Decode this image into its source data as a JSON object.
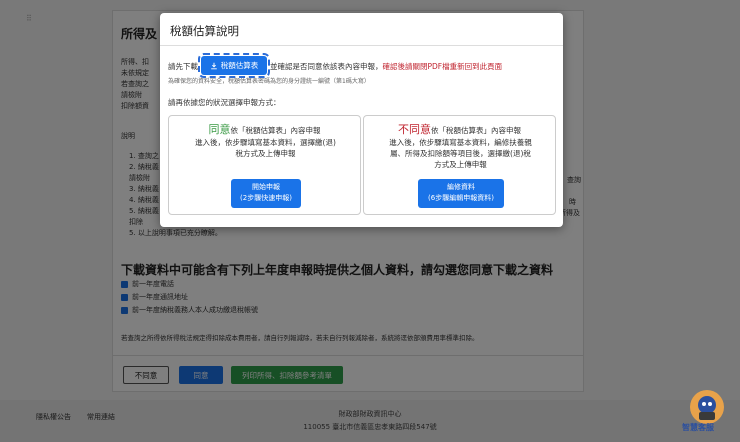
{
  "background": {
    "section_title": "所得及",
    "intro_lines": [
      "所得、扣",
      "未依規定",
      "若查詢之",
      "請檢附",
      "扣除額資"
    ],
    "explain_label": "說明",
    "list_items": [
      "1. 查詢之",
      "2. 納稅義",
      "   請檢附",
      "3. 納稅義",
      "4. 納稅義",
      "5. 納稅義",
      "   扣除",
      "5. 以上說明事項已充分瞭解。"
    ],
    "right_fragments": [
      "查詢",
      "時",
      "所得及"
    ],
    "download_title": "下載資料中可能含有下列上年度申報時提供之個人資料，請勾選您同意下載之資料",
    "checkboxes": [
      "前一年度電話",
      "前一年度通訊地址",
      "前一年度納稅義務人本人成功繳退稅帳號"
    ],
    "bottom_note": "若查詢之所得依所得稅法規定得扣除成本費用者，請自行列報減除，若未自行列報減除者，系統將逕依部頒費用率標準扣除。",
    "buttons": {
      "disagree": "不同意",
      "agree": "同意",
      "print": "列印所得、扣除額參考清單"
    }
  },
  "footer": {
    "links": [
      "隱私權公告",
      "常用連結"
    ],
    "org_name": "財政部財政資訊中心",
    "address": "110055 臺北市信義區忠孝東路四段547號"
  },
  "mascot": {
    "label": "智慧客服"
  },
  "modal": {
    "title": "稅額估算說明",
    "line1_prefix": "請先下載",
    "download_button": "稅額估算表",
    "line1_mid": "並確認是否同意依該表內容申報，",
    "line1_red": "確認後請關閉PDF檔重新回到此頁面",
    "note": "為確保您的資料安全，稅額估算表密碼為您的身分證統一編號（第1碼大寫）",
    "choose_prompt": "請再依據您的狀況選擇申報方式：",
    "options": [
      {
        "keyword": "同意",
        "head_rest": "依「稅額估算表」內容申報",
        "desc": [
          "進入後，依步驟填寫基本資料，選擇繳(退)",
          "稅方式及上傳申報"
        ],
        "action": [
          "開始申報",
          "(2步驟快速申報)"
        ]
      },
      {
        "keyword": "不同意",
        "head_rest": "依「稅額估算表」內容申報",
        "desc": [
          "進入後，依步驟填寫基本資料，編修扶養親",
          "屬、所得及扣除額等項目後，選擇繳(退)稅",
          "方式及上傳申報"
        ],
        "action": [
          "編修資料",
          "(6步驟編輯申報資料)"
        ]
      }
    ]
  }
}
